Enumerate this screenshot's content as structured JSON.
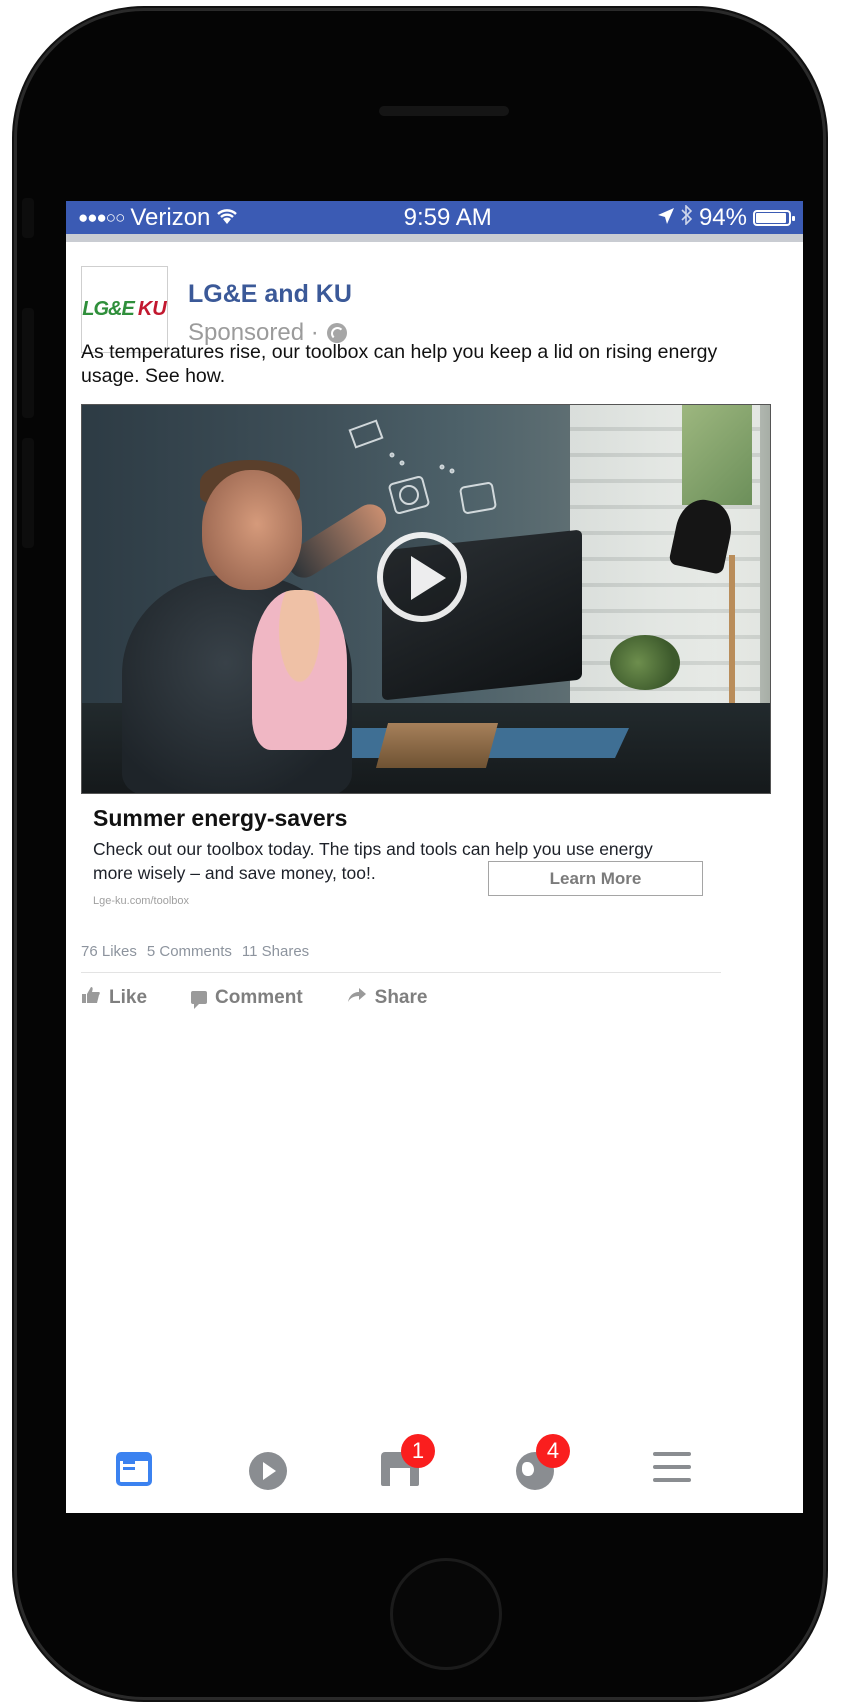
{
  "status_bar": {
    "signal_dots": "●●●○○",
    "carrier": "Verizon",
    "wifi_icon": "wifi-icon",
    "time": "9:59 AM",
    "location_icon": "location-arrow-icon",
    "bluetooth_icon": "bluetooth-icon",
    "battery_percent": "94%",
    "battery_level": 0.94,
    "background_color": "#3b5bb4"
  },
  "post": {
    "logo": {
      "left": "LG&E",
      "right": "KU"
    },
    "page_name": "LG&E and KU",
    "sponsored": "Sponsored ·",
    "text": "As temperatures rise, our toolbox can help you keep a lid on rising energy usage. See how.",
    "video": {
      "play_icon": "play-icon"
    },
    "link": {
      "title": "Summer energy-savers",
      "description": "Check out our toolbox today. The tips and tools can help you use energy more wisely – and save money, too!.",
      "url": "Lge-ku.com/toolbox",
      "cta": "Learn More"
    },
    "stats": {
      "likes": "76 Likes",
      "comments": "5 Comments",
      "shares": "11 Shares"
    },
    "actions": {
      "like": "Like",
      "comment": "Comment",
      "share": "Share"
    }
  },
  "tab_bar": {
    "tabs": [
      {
        "name": "news-feed",
        "icon": "news-feed-icon",
        "active": true
      },
      {
        "name": "video",
        "icon": "video-play-icon"
      },
      {
        "name": "marketplace",
        "icon": "marketplace-icon",
        "badge": "1"
      },
      {
        "name": "notifications",
        "icon": "globe-icon",
        "badge": "4"
      },
      {
        "name": "menu",
        "icon": "hamburger-menu-icon"
      }
    ]
  },
  "colors": {
    "facebook_blue": "#3b5998",
    "badge_red": "#fa1e1e",
    "active_tab": "#3b82f0"
  }
}
